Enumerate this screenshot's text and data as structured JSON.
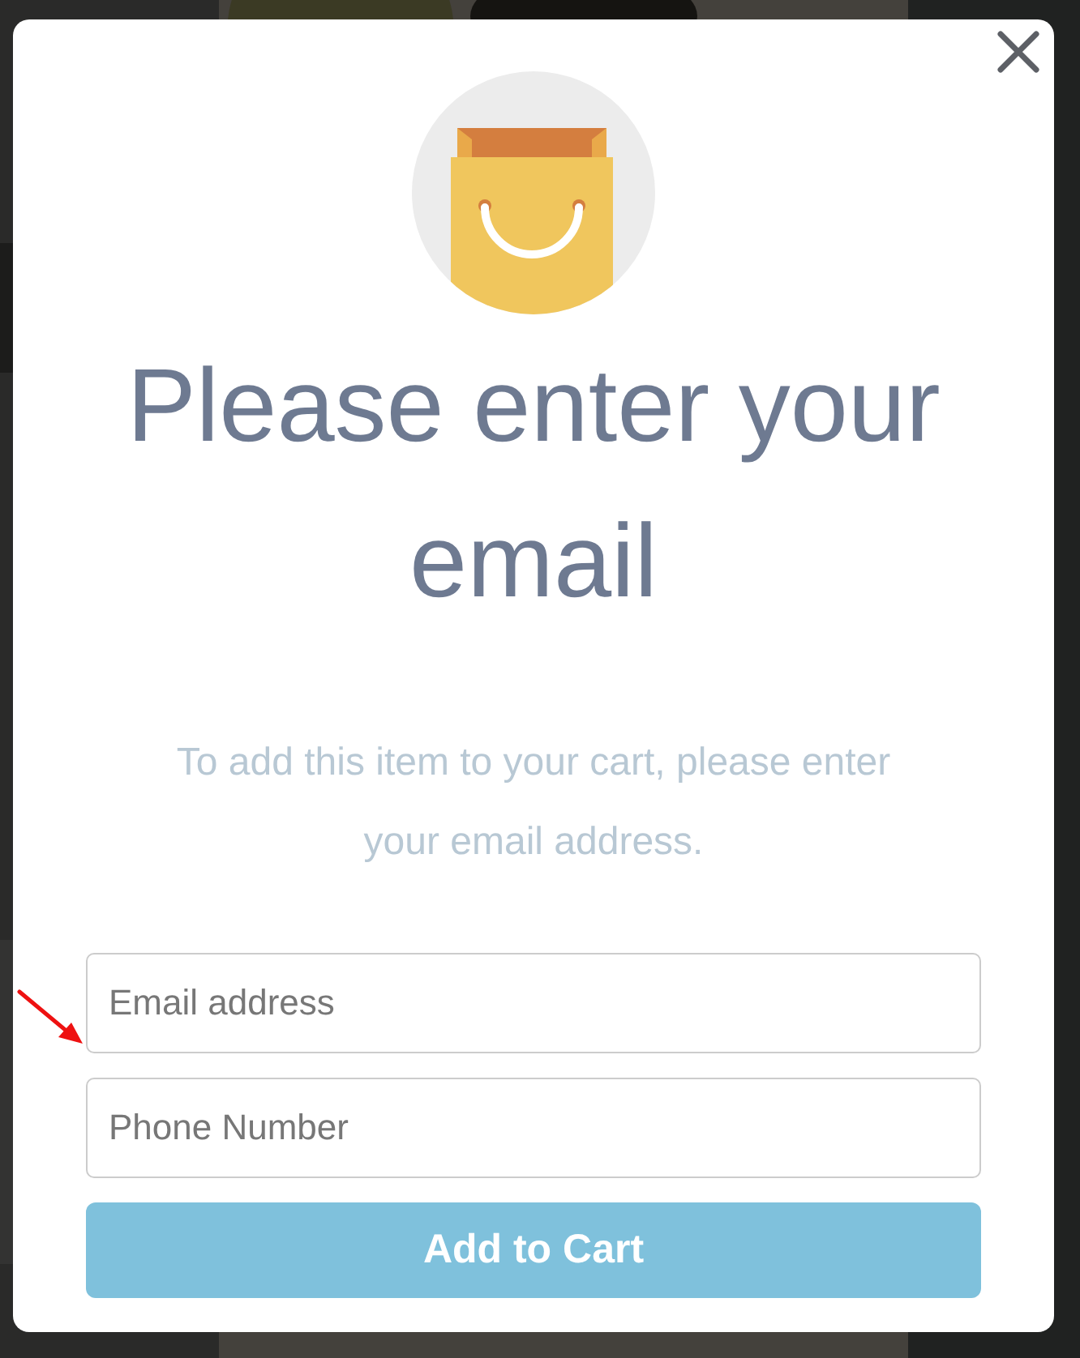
{
  "dialog": {
    "title": "Please enter your email",
    "message": "To add this item to your cart, please enter your email address.",
    "fields": [
      {
        "placeholder": "Email address"
      },
      {
        "placeholder": "Phone Number"
      }
    ],
    "button": {
      "label": "Add to Cart"
    }
  }
}
